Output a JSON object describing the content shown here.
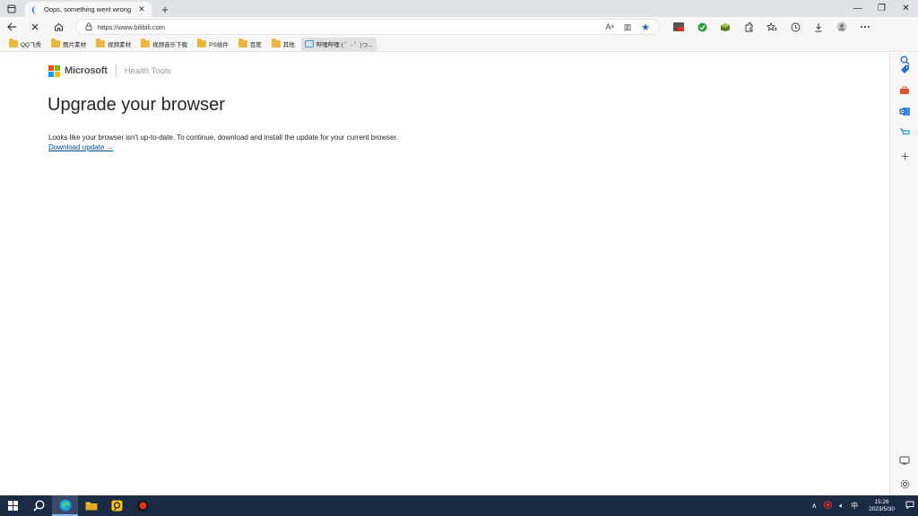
{
  "tab": {
    "title": "Oops, something went wrong",
    "close_glyph": "✕",
    "favicon": "edge-loading-icon"
  },
  "newtab_glyph": "+",
  "window": {
    "minimize": "—",
    "restore": "❐",
    "close": "✕"
  },
  "address": {
    "url": "https://www.bilibili.com"
  },
  "bookmarks": [
    {
      "label": "QQ飞秀"
    },
    {
      "label": "图片素材"
    },
    {
      "label": "视频素材"
    },
    {
      "label": "视频音乐下载"
    },
    {
      "label": "PS插件"
    },
    {
      "label": "百度"
    },
    {
      "label": "其他"
    },
    {
      "label": "哔哩哔哩 ( ゜- ゜)つ...",
      "active": true
    }
  ],
  "page": {
    "brand": "Microsoft",
    "product": "Health Tools",
    "heading": "Upgrade your browser",
    "description": "Looks like your browser isn't up-to-date. To continue, download and install the update for your current browser.",
    "link": "Download update →"
  },
  "taskbar": {
    "ime": "中",
    "time": "15:26",
    "date": "2023/5/30"
  },
  "colors": {
    "ms_red": "#f25022",
    "ms_green": "#7fba00",
    "ms_blue": "#00a4ef",
    "ms_yellow": "#ffb900",
    "link": "#0050a0",
    "taskbar": "#1c2b44"
  }
}
